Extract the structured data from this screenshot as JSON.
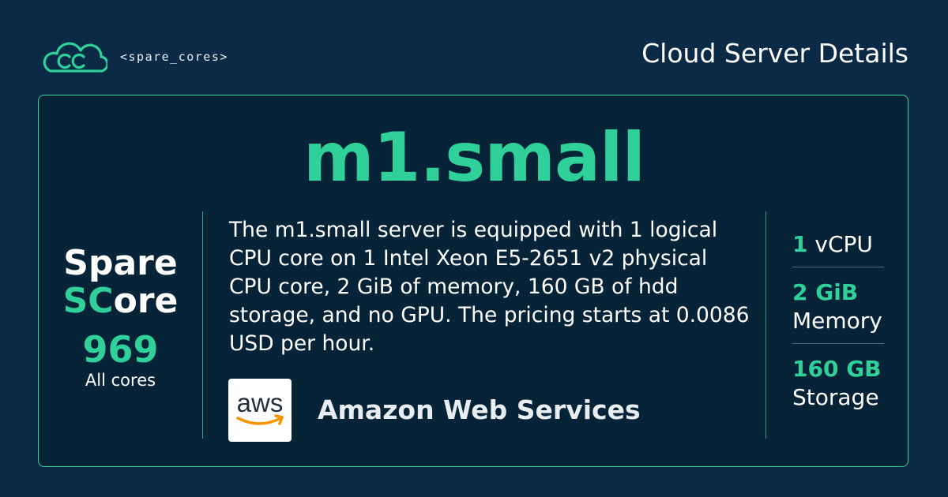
{
  "brand": {
    "name": "<spare_cores>",
    "logo_icon": "cloud-sc-icon",
    "accent_color": "#2fd09a",
    "background_color": "#0b2a45"
  },
  "header": {
    "title": "Cloud Server Details"
  },
  "server": {
    "name": "m1.small",
    "description": "The m1.small server is equipped with 1 logical CPU core on 1 Intel Xeon E5-2651 v2 physical CPU core, 2 GiB of memory, 160 GB of hdd storage, and no GPU. The pricing starts at 0.0086 USD per hour."
  },
  "score": {
    "line1": "Spare",
    "line2_accent": "SC",
    "line2_rest": "ore",
    "value": "969",
    "label": "All cores"
  },
  "vendor": {
    "logo_text": "aws",
    "logo_icon": "aws-logo-icon",
    "name": "Amazon Web Services"
  },
  "specs": [
    {
      "value": "1",
      "label": "vCPU"
    },
    {
      "value": "2 GiB",
      "label": "Memory"
    },
    {
      "value": "160 GB",
      "label": "Storage"
    }
  ]
}
